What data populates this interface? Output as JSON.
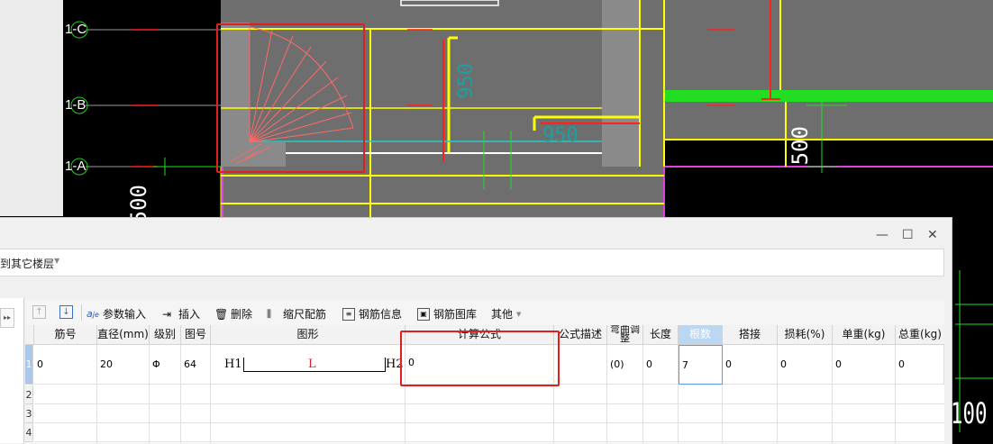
{
  "cad": {
    "axis_labels": [
      "1-C",
      "1-B",
      "1-A"
    ],
    "dimensions": [
      "950",
      "950",
      "500",
      "500",
      "100"
    ]
  },
  "dialog": {
    "controls": {
      "minimize": "—",
      "maximize": "☐",
      "close": "✕"
    },
    "floor_selector": "到其它楼层",
    "toolbar": {
      "move_up_icon": "arrow-up-icon",
      "move_down_icon": "arrow-down-icon",
      "param_input": "参数输入",
      "insert": "插入",
      "delete": "删除",
      "scale_rebar": "缩尺配筋",
      "rebar_info": "钢筋信息",
      "rebar_library": "钢筋图库",
      "other": "其他"
    },
    "table": {
      "columns": [
        "筋号",
        "直径(mm)",
        "级别",
        "图号",
        "图形",
        "计算公式",
        "公式描述",
        "弯曲调整",
        "长度",
        "根数",
        "搭接",
        "损耗(%)",
        "单重(kg)",
        "总重(kg)"
      ],
      "selected_column": "根数",
      "rows": [
        {
          "no": "1",
          "bar_no": "0",
          "diameter": "20",
          "grade": "Φ",
          "shape_no": "64",
          "shape_left": "H1",
          "shape_mid": "L",
          "shape_right": "H2",
          "formula": "0",
          "formula_desc": "",
          "bend_adjust": "(0)",
          "length": "0",
          "count": "7",
          "lap": "0",
          "loss": "0",
          "unit_weight": "0",
          "total_weight": "0"
        }
      ],
      "empty_rows": [
        "2",
        "3",
        "4"
      ]
    }
  },
  "colors": {
    "highlight": "#e02020",
    "cad_bg": "#000000",
    "slab": "#6e6e6e",
    "beam": "#ffff00",
    "selected_header": "#bcd7f2"
  }
}
